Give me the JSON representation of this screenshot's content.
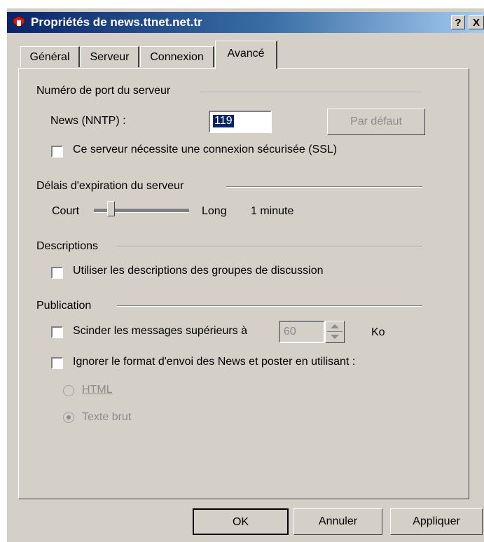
{
  "window": {
    "title": "Propriétés de news.ttnet.net.tr",
    "help_label": "?",
    "close_label": "X"
  },
  "tabs": [
    {
      "label": "Général"
    },
    {
      "label": "Serveur"
    },
    {
      "label": "Connexion"
    },
    {
      "label": "Avancé"
    }
  ],
  "port_group": {
    "title": "Numéro de port du serveur",
    "news_label": "News (NNTP) :",
    "news_value": "119",
    "default_button": "Par défaut",
    "ssl_label": "Ce serveur nécessite une connexion sécurisée (SSL)"
  },
  "timeout_group": {
    "title": "Délais d'expiration du serveur",
    "short_label": "Court",
    "long_label": "Long",
    "value_text": "1 minute",
    "slider_level": 0.15
  },
  "descriptions_group": {
    "title": "Descriptions",
    "use_descriptions_label": "Utiliser les descriptions des groupes de discussion"
  },
  "publication_group": {
    "title": "Publication",
    "split_label": "Scinder les messages supérieurs à",
    "split_value": "60",
    "split_unit": "Ko",
    "ignore_format_label": "Ignorer le format d'envoi des News et poster en utilisant :",
    "radio_html": "HTML",
    "radio_plain": "Texte brut"
  },
  "footer": {
    "ok": "OK",
    "cancel": "Annuler",
    "apply": "Appliquer"
  }
}
